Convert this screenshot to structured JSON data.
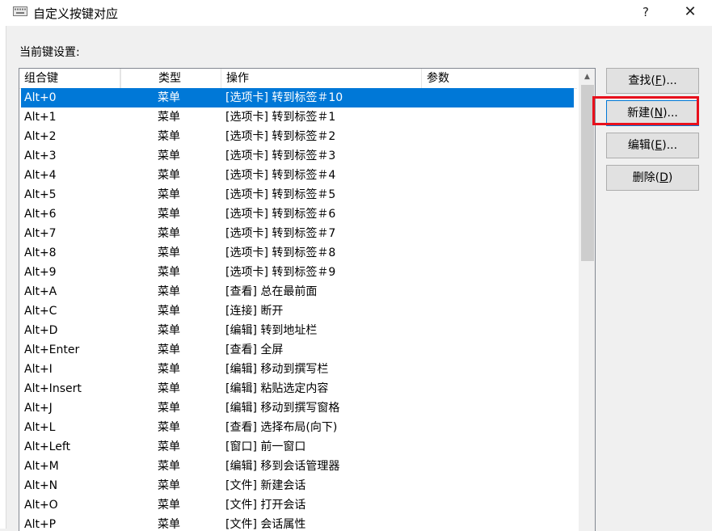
{
  "window": {
    "title": "自定义按键对应",
    "help_label": "?",
    "close_label": "✕",
    "icon": "keyboard-icon"
  },
  "section_label": "当前键设置:",
  "table": {
    "columns": [
      "组合键",
      "类型",
      "操作",
      "参数"
    ],
    "rows": [
      {
        "key": "Alt+0",
        "type": "菜单",
        "action": "[选项卡] 转到标签＃10"
      },
      {
        "key": "Alt+1",
        "type": "菜单",
        "action": "[选项卡] 转到标签＃1"
      },
      {
        "key": "Alt+2",
        "type": "菜单",
        "action": "[选项卡] 转到标签＃2"
      },
      {
        "key": "Alt+3",
        "type": "菜单",
        "action": "[选项卡] 转到标签＃3"
      },
      {
        "key": "Alt+4",
        "type": "菜单",
        "action": "[选项卡] 转到标签＃4"
      },
      {
        "key": "Alt+5",
        "type": "菜单",
        "action": "[选项卡] 转到标签＃5"
      },
      {
        "key": "Alt+6",
        "type": "菜单",
        "action": "[选项卡] 转到标签＃6"
      },
      {
        "key": "Alt+7",
        "type": "菜单",
        "action": "[选项卡] 转到标签＃7"
      },
      {
        "key": "Alt+8",
        "type": "菜单",
        "action": "[选项卡] 转到标签＃8"
      },
      {
        "key": "Alt+9",
        "type": "菜单",
        "action": "[选项卡] 转到标签＃9"
      },
      {
        "key": "Alt+A",
        "type": "菜单",
        "action": "[查看] 总在最前面"
      },
      {
        "key": "Alt+C",
        "type": "菜单",
        "action": "[连接] 断开"
      },
      {
        "key": "Alt+D",
        "type": "菜单",
        "action": "[编辑] 转到地址栏"
      },
      {
        "key": "Alt+Enter",
        "type": "菜单",
        "action": "[查看] 全屏"
      },
      {
        "key": "Alt+I",
        "type": "菜单",
        "action": "[编辑] 移动到撰写栏"
      },
      {
        "key": "Alt+Insert",
        "type": "菜单",
        "action": "[编辑] 粘贴选定内容"
      },
      {
        "key": "Alt+J",
        "type": "菜单",
        "action": "[编辑] 移动到撰写窗格"
      },
      {
        "key": "Alt+L",
        "type": "菜单",
        "action": "[查看] 选择布局(向下)"
      },
      {
        "key": "Alt+Left",
        "type": "菜单",
        "action": "[窗口] 前一窗口"
      },
      {
        "key": "Alt+M",
        "type": "菜单",
        "action": "[编辑] 移到会话管理器"
      },
      {
        "key": "Alt+N",
        "type": "菜单",
        "action": "[文件] 新建会话"
      },
      {
        "key": "Alt+O",
        "type": "菜单",
        "action": "[文件] 打开会话"
      },
      {
        "key": "Alt+P",
        "type": "菜单",
        "action": "[文件] 会话属性"
      }
    ],
    "selected_index": 0
  },
  "buttons": {
    "find": {
      "text": "查找(",
      "mnemonic": "F",
      "suffix": ")..."
    },
    "new": {
      "text": "新建(",
      "mnemonic": "N",
      "suffix": ")..."
    },
    "edit": {
      "text": "编辑(",
      "mnemonic": "E",
      "suffix": ")..."
    },
    "delete": {
      "text": "删除(",
      "mnemonic": "D",
      "suffix": ")"
    }
  },
  "colors": {
    "selection": "#0078d7",
    "highlight_box": "#e8101c"
  }
}
